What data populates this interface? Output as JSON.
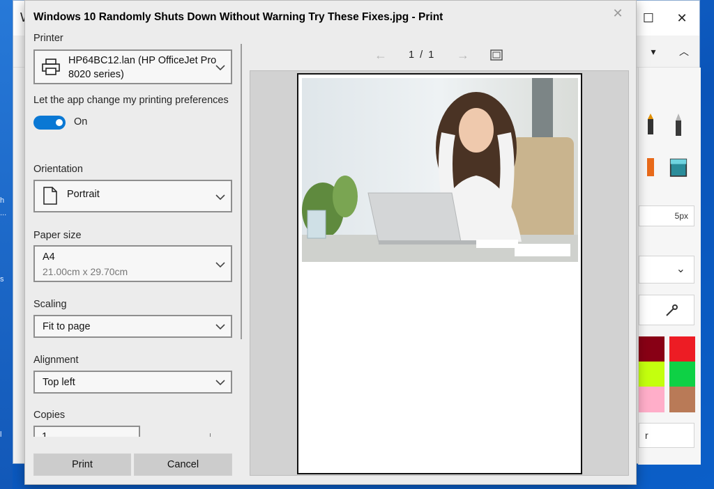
{
  "desktop": {
    "fragments": [
      "h",
      "...",
      "s",
      "l"
    ]
  },
  "background_app": {
    "title_fragment": "W",
    "controls": {
      "minimize": "—",
      "maximize": "☐",
      "close": "✕"
    },
    "ribbon": {
      "menu_chevron": "▾",
      "collapse": "︿"
    },
    "brush_size": "5px",
    "dropdown_chevron": "⌄",
    "partial_button_label": "r",
    "palette": [
      "#880015",
      "#ed1c24",
      "#c4ff0e",
      "#0ed145",
      "#ffaec9",
      "#b97a57"
    ]
  },
  "dialog": {
    "title": "Windows 10 Randomly Shuts Down Without Warning Try These Fixes.jpg - Print",
    "close_glyph": "✕",
    "printer": {
      "label": "Printer",
      "value_line1": "HP64BC12.lan (HP OfficeJet Pro",
      "value_line2": "8020 series)"
    },
    "preferences": {
      "label": "Let the app change my printing preferences",
      "toggle_state": "On"
    },
    "orientation": {
      "label": "Orientation",
      "value": "Portrait"
    },
    "paper_size": {
      "label": "Paper size",
      "value": "A4",
      "dimensions": "21.00cm x 29.70cm"
    },
    "scaling": {
      "label": "Scaling",
      "value": "Fit to page"
    },
    "alignment": {
      "label": "Alignment",
      "value": "Top left"
    },
    "copies": {
      "label": "Copies",
      "value": "1"
    },
    "buttons": {
      "print": "Print",
      "cancel": "Cancel"
    },
    "preview": {
      "page_current": "1",
      "page_total": "1",
      "separator": "/",
      "prev_glyph": "←",
      "next_glyph": "→"
    }
  }
}
